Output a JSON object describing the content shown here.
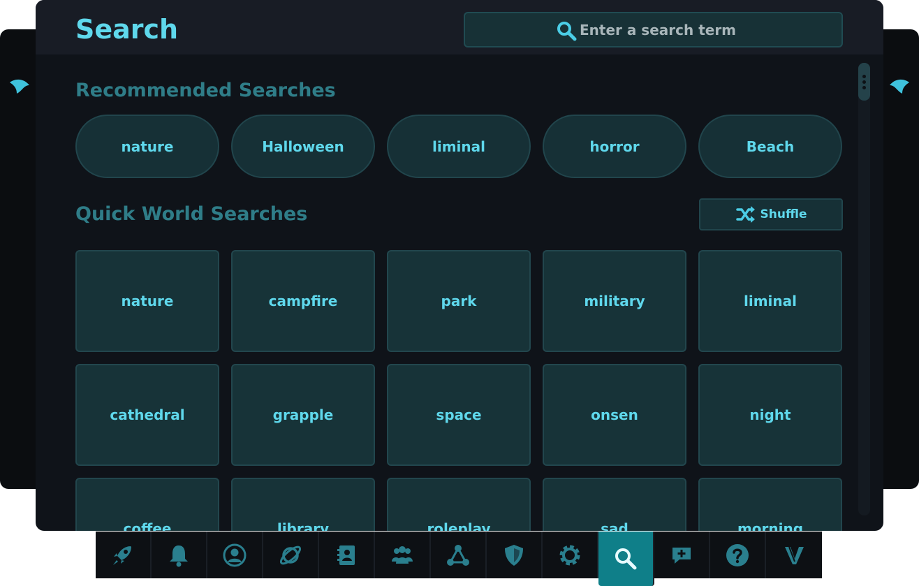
{
  "header": {
    "title": "Search",
    "search_placeholder": "Enter a search term",
    "search_icon": "search-icon"
  },
  "recommended": {
    "title": "Recommended Searches",
    "items": [
      "nature",
      "Halloween",
      "liminal",
      "horror",
      "Beach"
    ]
  },
  "quick": {
    "title": "Quick World Searches",
    "shuffle_label": "Shuffle",
    "shuffle_icon": "shuffle-icon",
    "items": [
      "nature",
      "campfire",
      "park",
      "military",
      "liminal",
      "cathedral",
      "grapple",
      "space",
      "onsen",
      "night",
      "coffee",
      "library",
      "roleplay",
      "sad",
      "morning"
    ]
  },
  "nav": {
    "items": [
      "rocket-icon",
      "bell-icon",
      "profile-icon",
      "planet-icon",
      "contacts-book-icon",
      "group-icon",
      "network-icon",
      "shield-icon",
      "gear-icon",
      "search-icon",
      "chat-add-icon",
      "help-icon",
      "logo-v-icon"
    ],
    "active": "search-icon"
  },
  "colors": {
    "accent": "#5fd8ec",
    "section_title": "#2f7d88",
    "active_nav": "#0f7f89",
    "tile_bg": "#173338"
  }
}
